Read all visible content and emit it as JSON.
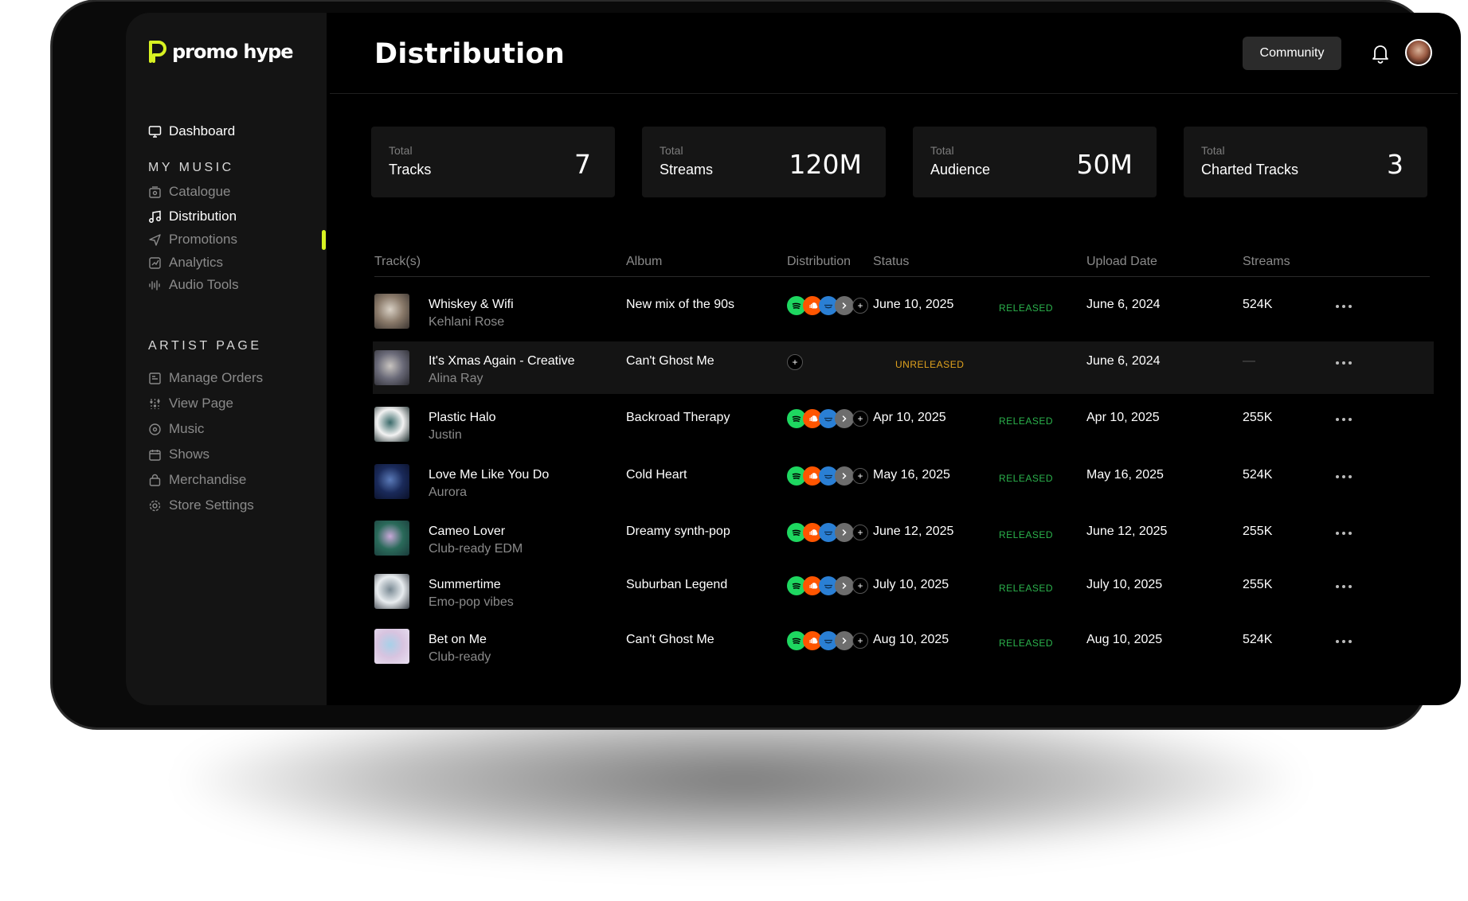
{
  "app": {
    "logo_text": "promo hype",
    "brand_accent": "#d8f222"
  },
  "sidebar": {
    "dashboard": {
      "label": "Dashboard",
      "icon": "monitor-icon"
    },
    "my_music_title": "MY MUSIC",
    "my_music_items": [
      {
        "label": "Catalogue",
        "icon": "catalogue-icon"
      },
      {
        "label": "Distribution",
        "icon": "music-note-icon",
        "active": true
      },
      {
        "label": "Promotions",
        "icon": "send-icon"
      },
      {
        "label": "Analytics",
        "icon": "analytics-icon"
      },
      {
        "label": "Audio Tools",
        "icon": "waveform-icon"
      }
    ],
    "artist_page_title": "ARTIST PAGE",
    "artist_page_items": [
      {
        "label": "Manage Orders",
        "icon": "orders-icon"
      },
      {
        "label": "View Page",
        "icon": "sliders-icon"
      },
      {
        "label": "Music",
        "icon": "disc-icon"
      },
      {
        "label": "Shows",
        "icon": "calendar-icon"
      },
      {
        "label": "Merchandise",
        "icon": "bag-icon"
      },
      {
        "label": "Store Settings",
        "icon": "gear-icon"
      }
    ]
  },
  "header": {
    "title": "Distribution",
    "community_label": "Community",
    "bell_icon": "bell-icon",
    "avatar_icon": "user-avatar"
  },
  "stats": [
    {
      "small": "Total",
      "label": "Tracks",
      "value": "7"
    },
    {
      "small": "Total",
      "label": "Streams",
      "value": "120M"
    },
    {
      "small": "Total",
      "label": "Audience",
      "value": "50M"
    },
    {
      "small": "Total",
      "label": "Charted Tracks",
      "value": "3"
    }
  ],
  "table": {
    "columns": [
      "Track(s)",
      "Album",
      "Distribution",
      "Status",
      "Upload Date",
      "Streams"
    ],
    "rows": [
      {
        "title": "Whiskey & Wifi",
        "artist": "Kehlani Rose",
        "album": "New mix of the 90s",
        "distributed": true,
        "status_date": "June 10, 2025",
        "status": "RELEASED",
        "upload": "June 6, 2024",
        "streams": "524K",
        "thumb": [
          "#8a7a6a",
          "#d8d0c4",
          "#3a3430"
        ]
      },
      {
        "title": "It's Xmas Again - Creative",
        "artist": "Alina Ray",
        "album": "Can't Ghost Me",
        "distributed": false,
        "status_date": "",
        "status": "UNRELEASED",
        "upload": "June 6, 2024",
        "streams": "—",
        "thumb": [
          "#6a6a78",
          "#c8c4c0",
          "#2a2a30"
        ],
        "highlight": true
      },
      {
        "title": "Plastic Halo",
        "artist": "Justin",
        "album": "Backroad Therapy",
        "distributed": true,
        "status_date": "Apr 10, 2025",
        "status": "RELEASED",
        "upload": "Apr 10, 2025",
        "streams": "255K",
        "thumb": [
          "#f2f2f2",
          "#3a6a6a",
          "#1a2a2a"
        ]
      },
      {
        "title": "Love Me Like You Do",
        "artist": "Aurora",
        "album": "Cold Heart",
        "distributed": true,
        "status_date": "May 16, 2025",
        "status": "RELEASED",
        "upload": "May 16, 2025",
        "streams": "524K",
        "thumb": [
          "#1a2a5a",
          "#5a7ab8",
          "#0a1028"
        ]
      },
      {
        "title": "Cameo Lover",
        "artist": "Club-ready EDM",
        "album": "Dreamy synth-pop",
        "distributed": true,
        "status_date": "June 12, 2025",
        "status": "RELEASED",
        "upload": "June 12, 2025",
        "streams": "255K",
        "thumb": [
          "#2a6a5a",
          "#c8a8d8",
          "#1a3a3a"
        ]
      },
      {
        "title": "Summertime",
        "artist": "Emo-pop vibes",
        "album": "Suburban Legend",
        "distributed": true,
        "status_date": "July 10, 2025",
        "status": "RELEASED",
        "upload": "July 10, 2025",
        "streams": "255K",
        "thumb": [
          "#e8ecef",
          "#7a8a94",
          "#3a4048"
        ]
      },
      {
        "title": "Bet on Me",
        "artist": "Club-ready",
        "album": "Can't Ghost Me",
        "distributed": true,
        "status_date": "Aug 10, 2025",
        "status": "RELEASED",
        "upload": "Aug 10, 2025",
        "streams": "524K",
        "thumb": [
          "#d8c4e0",
          "#a8d0e8",
          "#e8e0f0"
        ]
      }
    ]
  },
  "status_colors": {
    "RELEASED": "#2bb24c",
    "UNRELEASED": "#e0a21e"
  },
  "distribution_icons": [
    "spotify-icon",
    "soundcloud-icon",
    "amazon-music-icon",
    "more-platforms-icon",
    "add-platform-icon"
  ],
  "platform_colors": {
    "spotify": "#1ed760",
    "soundcloud": "#ff5500",
    "amazon": "#2a7fd4",
    "more": "#6d6d6d"
  }
}
